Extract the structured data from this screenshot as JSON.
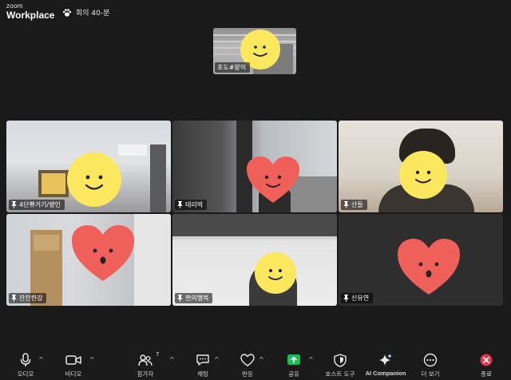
{
  "app": {
    "brand_top": "zoom",
    "brand_bottom": "Workplace",
    "meeting_title": "회의 40-분"
  },
  "featured": {
    "name": "포도#왕이"
  },
  "participants": [
    {
      "name": "4단쀼거기/병인",
      "emoji": "smile"
    },
    {
      "name": "테리벅",
      "emoji": "heart"
    },
    {
      "name": "산들",
      "emoji": "smile"
    },
    {
      "name": "잔잔한강",
      "emoji": "heart"
    },
    {
      "name": "쩐의행복",
      "emoji": "smile"
    },
    {
      "name": "신유연",
      "emoji": "heart"
    }
  ],
  "colors": {
    "smile_yellow": "#fce85e",
    "heart_red": "#f0605a",
    "share_green": "#1dbb56",
    "end_red": "#e8344a"
  },
  "toolbar": {
    "audio": "오디오",
    "video": "비디오",
    "participants": "참가자",
    "participants_count": "7",
    "chat": "채팅",
    "react": "반응",
    "share": "공유",
    "host_tools": "호스트 도구",
    "ai_companion": "AI Companion",
    "more": "더 보기",
    "end": "종료"
  }
}
